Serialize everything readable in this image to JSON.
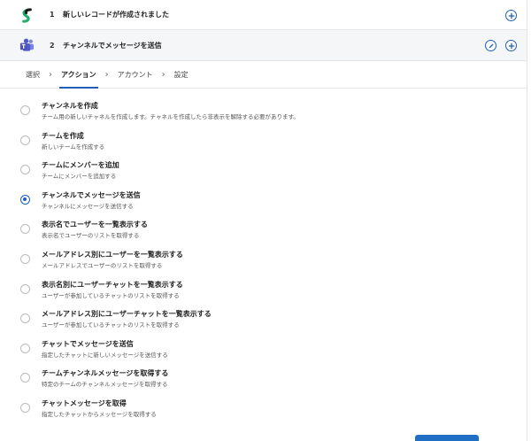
{
  "steps": [
    {
      "number": "1",
      "title": "新しいレコードが作成されました",
      "icon": "shortcut-logo-icon"
    },
    {
      "number": "2",
      "title": "チャンネルでメッセージを送信",
      "icon": "teams-logo-icon"
    }
  ],
  "breadcrumb": [
    "選択",
    "アクション",
    "アカウント",
    "設定"
  ],
  "options": [
    {
      "label": "チャンネルを作成",
      "desc": "チーム用の新しいチャネルを作成します。チャネルを作成したら非表示を解除する必要があります。",
      "checked": false
    },
    {
      "label": "チームを作成",
      "desc": "新しいチームを作成する",
      "checked": false
    },
    {
      "label": "チームにメンバーを追加",
      "desc": "チームにメンバーを追加する",
      "checked": false
    },
    {
      "label": "チャンネルでメッセージを送信",
      "desc": "チャンネルにメッセージを送信する",
      "checked": true
    },
    {
      "label": "表示名でユーザーを一覧表示する",
      "desc": "表示名でユーザーのリストを取得する",
      "checked": false
    },
    {
      "label": "メールアドレス別にユーザーを一覧表示する",
      "desc": "メールアドレスでユーザーのリストを取得する",
      "checked": false
    },
    {
      "label": "表示名別にユーザーチャットを一覧表示する",
      "desc": "ユーザーが参加しているチャットのリストを取得する",
      "checked": false
    },
    {
      "label": "メールアドレス別にユーザーチャットを一覧表示する",
      "desc": "ユーザーが参加しているチャットのリストを取得する",
      "checked": false
    },
    {
      "label": "チャットでメッセージを送信",
      "desc": "指定したチャットに新しいメッセージを送信する",
      "checked": false
    },
    {
      "label": "チームチャンネルメッセージを取得する",
      "desc": "特定のチームのチャンネルメッセージを取得する",
      "checked": false
    },
    {
      "label": "チャットメッセージを取得",
      "desc": "指定したチャットからメッセージを取得する",
      "checked": false
    }
  ],
  "colors": {
    "accent": "#1f5fb8",
    "primary_button": "#1f6fc4"
  }
}
